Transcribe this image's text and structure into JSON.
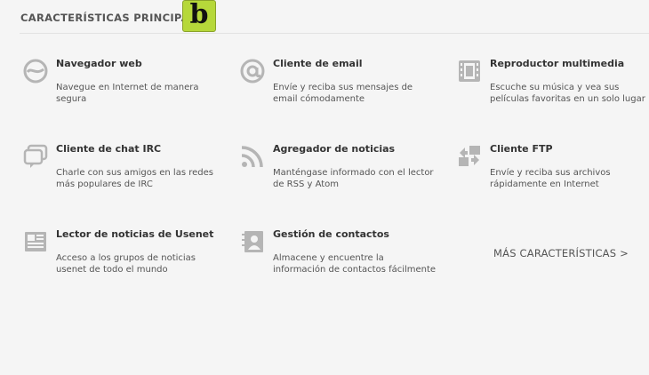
{
  "header": {
    "title": "CARACTERÍSTICAS PRINCIPALES",
    "badge_letter": "b"
  },
  "features": [
    {
      "icon": "web-browser-icon",
      "title": "Navegador web",
      "description": "Navegue en Internet de manera segura"
    },
    {
      "icon": "email-at-icon",
      "title": "Cliente de email",
      "description": "Envíe y reciba sus mensajes de email cómodamente"
    },
    {
      "icon": "film-icon",
      "title": "Reproductor multimedia",
      "description": "Escuche su música y vea sus películas favoritas en un solo lugar"
    },
    {
      "icon": "chat-bubble-icon",
      "title": "Cliente de chat IRC",
      "description": "Charle con sus amigos en las redes más populares de IRC"
    },
    {
      "icon": "rss-icon",
      "title": "Agregador de noticias",
      "description": "Manténgase informado con el lector de RSS y Atom"
    },
    {
      "icon": "ftp-transfer-icon",
      "title": "Cliente FTP",
      "description": "Envíe y reciba sus archivos rápidamente en Internet"
    },
    {
      "icon": "newspaper-icon",
      "title": "Lector de noticias de Usenet",
      "description": "Acceso a los grupos de noticias usenet de todo el mundo"
    },
    {
      "icon": "contacts-book-icon",
      "title": "Gestión de contactos",
      "description": "Almacene y encuentre la información de contactos fácilmente"
    }
  ],
  "more_link": "MÁS CARACTERÍSTICAS >"
}
